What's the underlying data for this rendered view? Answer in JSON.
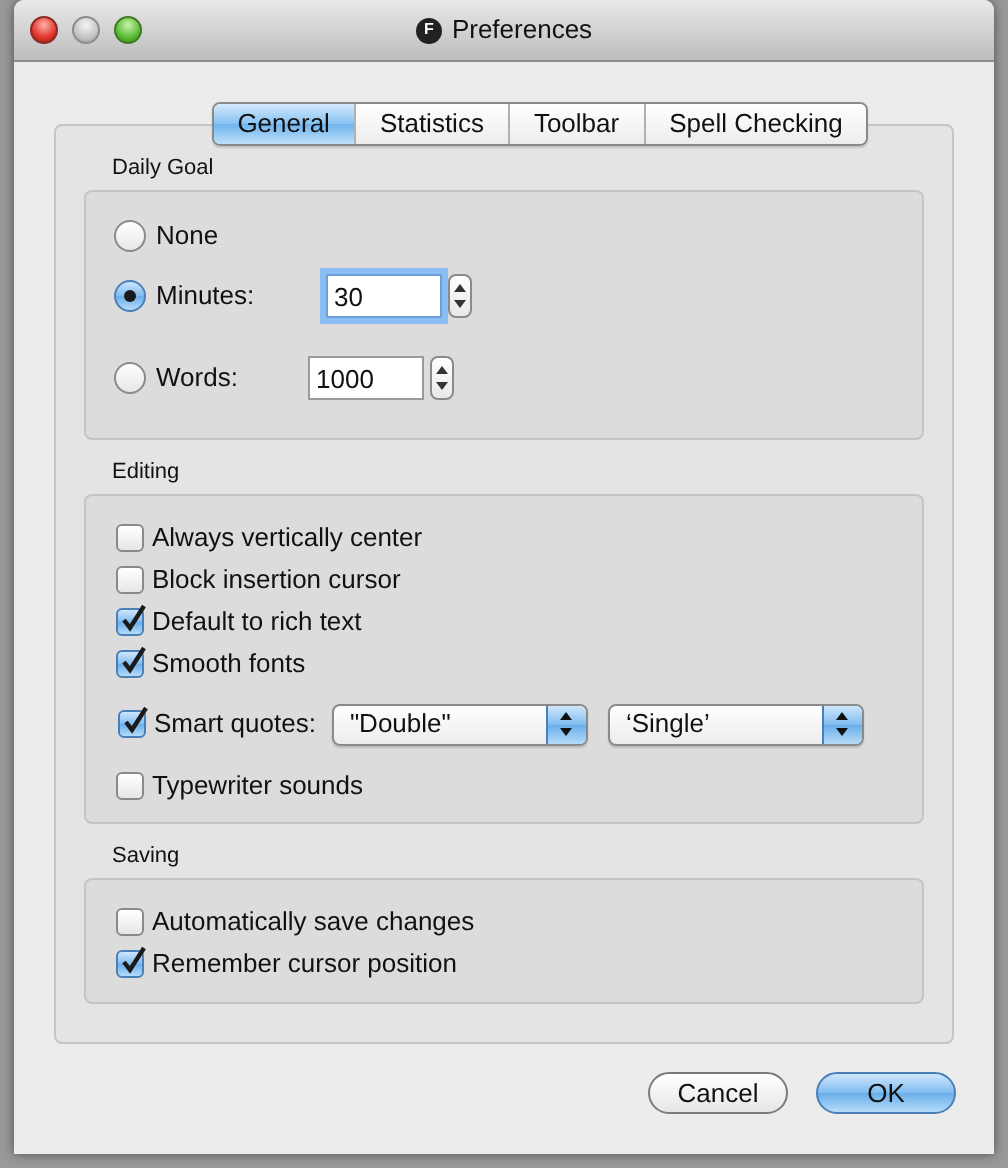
{
  "window": {
    "title": "Preferences",
    "app_icon_letter": "F"
  },
  "tabs": [
    {
      "label": "General",
      "selected": true
    },
    {
      "label": "Statistics",
      "selected": false
    },
    {
      "label": "Toolbar",
      "selected": false
    },
    {
      "label": "Spell Checking",
      "selected": false
    }
  ],
  "daily_goal": {
    "title": "Daily Goal",
    "options": [
      {
        "label": "None",
        "selected": false
      },
      {
        "label": "Minutes:",
        "selected": true,
        "field": {
          "value": "30",
          "focused": true
        }
      },
      {
        "label": "Words:",
        "selected": false,
        "field": {
          "value": "1000",
          "focused": false
        }
      }
    ]
  },
  "editing": {
    "title": "Editing",
    "items": [
      {
        "kind": "checkbox",
        "label": "Always vertically center",
        "checked": false
      },
      {
        "kind": "checkbox",
        "label": "Block insertion cursor",
        "checked": false
      },
      {
        "kind": "checkbox",
        "label": "Default to rich text",
        "checked": true
      },
      {
        "kind": "checkbox",
        "label": "Smooth fonts",
        "checked": true
      },
      {
        "kind": "checkbox_selects",
        "label": "Smart quotes:",
        "checked": true,
        "selects": [
          "\"Double\"",
          "‘Single’"
        ]
      },
      {
        "kind": "checkbox",
        "label": "Typewriter sounds",
        "checked": false
      }
    ]
  },
  "saving": {
    "title": "Saving",
    "items": [
      {
        "kind": "checkbox",
        "label": "Automatically save changes",
        "checked": false
      },
      {
        "kind": "checkbox",
        "label": "Remember cursor position",
        "checked": true
      }
    ]
  },
  "buttons": [
    {
      "label": "Cancel",
      "default": false
    },
    {
      "label": "OK",
      "default": true
    }
  ]
}
